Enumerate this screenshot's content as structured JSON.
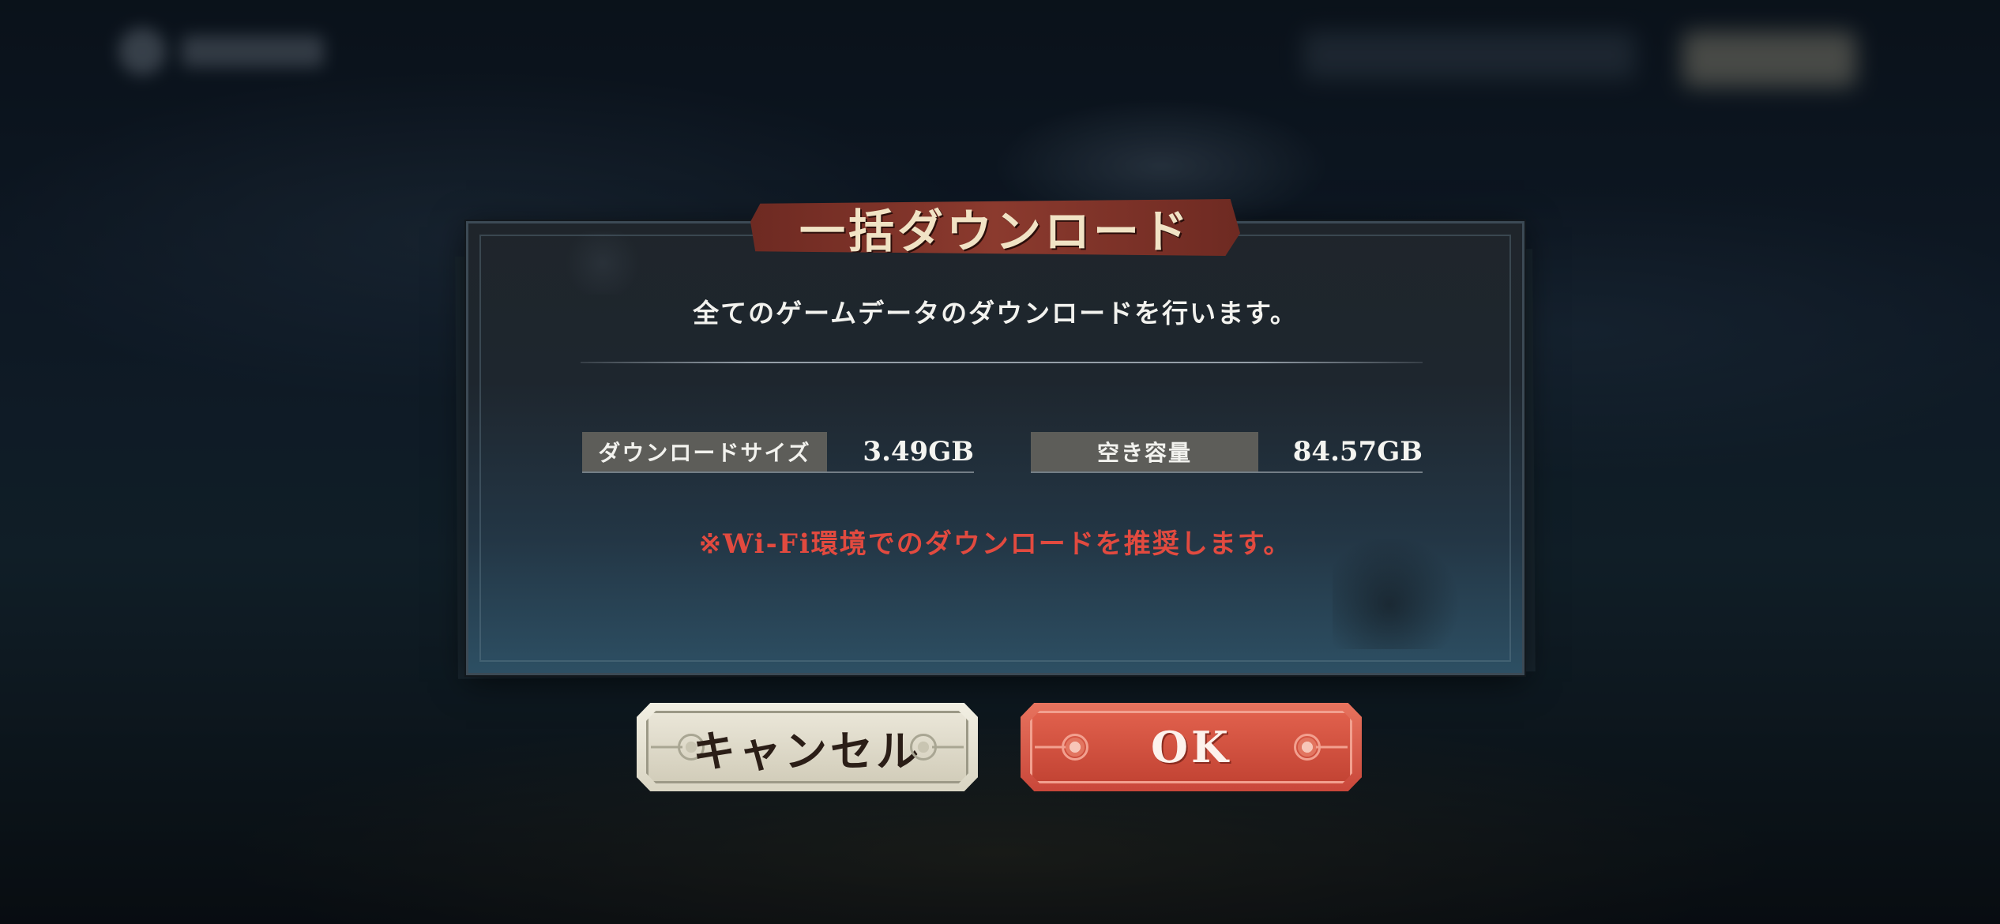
{
  "dialog": {
    "title": "一括ダウンロード",
    "message": "全てのゲームデータのダウンロードを行います。",
    "download_size": {
      "label": "ダウンロードサイズ",
      "value": "3.49GB"
    },
    "free_space": {
      "label": "空き容量",
      "value": "84.57GB"
    },
    "warning": "※Wi-Fi環境でのダウンロードを推奨します。"
  },
  "buttons": {
    "cancel_label": "キャンセル",
    "ok_label": "OK"
  },
  "colors": {
    "warning_text": "#e24a3f",
    "ok_button": "#d85a48",
    "cancel_button": "#e4e0cf",
    "title_ribbon": "#7a3026"
  }
}
